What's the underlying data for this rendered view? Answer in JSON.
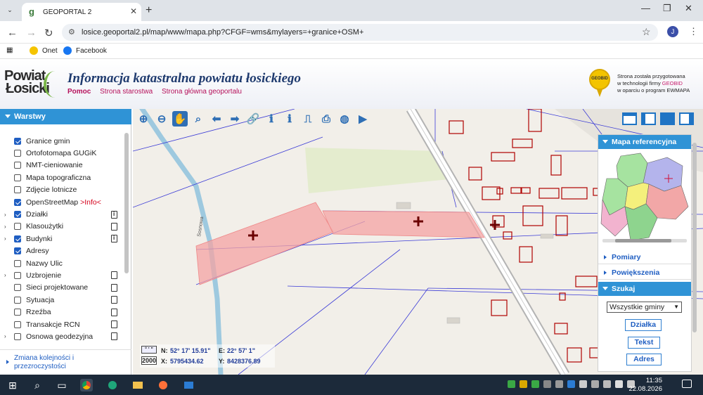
{
  "browser": {
    "tab_title": "GEOPORTAL 2",
    "favicon": "g",
    "url": "losice.geoportal2.pl/map/www/mapa.php?CFGF=wms&mylayers=+granice+OSM+",
    "profile_initial": "J",
    "bookmarks": [
      {
        "label": "Onet",
        "icon": "onet-icon",
        "color": "#f5c400"
      },
      {
        "label": "Facebook",
        "icon": "facebook-icon",
        "color": "#1877f2"
      }
    ]
  },
  "header": {
    "logo_line1": "Powiat",
    "logo_line2": "Łosicki",
    "title": "Informacja katastralna powiatu łosickiego",
    "links": [
      "Pomoc",
      "Strona starostwa",
      "Strona główna geoportalu"
    ],
    "geobid_badge": "GEOBID",
    "geobid_text1": "Strona została przygotowana",
    "geobid_text2_pre": "w technologii firmy ",
    "geobid_text2_link": "GEOBID",
    "geobid_text3": "w oparciu o program EWMAPA"
  },
  "left_panel": {
    "title": "Warstwy",
    "layers": [
      {
        "label": "Granice gmin",
        "checked": true,
        "expandable": false,
        "doc": ""
      },
      {
        "label": "Ortofotomapa GUGiK",
        "checked": false,
        "expandable": false,
        "doc": ""
      },
      {
        "label": "NMT-cieniowanie",
        "checked": false,
        "expandable": false,
        "doc": ""
      },
      {
        "label": "Mapa topograficzna",
        "checked": false,
        "expandable": false,
        "doc": ""
      },
      {
        "label": "Zdjęcie lotnicze",
        "checked": false,
        "expandable": false,
        "doc": ""
      },
      {
        "label": "OpenStreetMap",
        "info": ">Info<",
        "checked": true,
        "expandable": false,
        "doc": ""
      },
      {
        "label": "Działki",
        "checked": true,
        "expandable": true,
        "doc": "info"
      },
      {
        "label": "Klasoużytki",
        "checked": false,
        "expandable": true,
        "doc": "doc"
      },
      {
        "label": "Budynki",
        "checked": true,
        "expandable": true,
        "doc": "info"
      },
      {
        "label": "Adresy",
        "checked": true,
        "expandable": false,
        "doc": ""
      },
      {
        "label": "Nazwy Ulic",
        "checked": false,
        "expandable": false,
        "doc": ""
      },
      {
        "label": "Uzbrojenie",
        "checked": false,
        "expandable": true,
        "doc": "doc"
      },
      {
        "label": "Sieci projektowane",
        "checked": false,
        "expandable": false,
        "doc": "doc"
      },
      {
        "label": "Sytuacja",
        "checked": false,
        "expandable": false,
        "doc": "doc"
      },
      {
        "label": "Rzeźba",
        "checked": false,
        "expandable": false,
        "doc": "doc"
      },
      {
        "label": "Transakcje RCN",
        "checked": false,
        "expandable": false,
        "doc": "doc"
      },
      {
        "label": "Osnowa geodezyjna",
        "checked": false,
        "expandable": true,
        "doc": "doc"
      }
    ],
    "footer_line1": "Zmiana kolejności i",
    "footer_line2": "przezroczystości"
  },
  "map": {
    "road_label": "Sosnowa",
    "coords": {
      "format": "° ' \"",
      "scale": "2000",
      "n_label": "N:",
      "n_value": "52° 17' 15.91\"",
      "e_label": "E:",
      "e_value": "22° 57' 1\"",
      "x_label": "X:",
      "x_value": "5795434.62",
      "y_label": "Y:",
      "y_value": "8428376.89"
    },
    "toolbar": [
      "zoom-in-icon",
      "zoom-out-icon",
      "pan-hand-icon",
      "zoom-window-icon",
      "back-arrow-icon",
      "forward-arrow-icon",
      "link-icon",
      "info-icon",
      "info-extended-icon",
      "measure-icon",
      "print-icon",
      "globe-icon",
      "camera-icon"
    ]
  },
  "right_panel": {
    "ref_title": "Mapa referencyjna",
    "pomiary": "Pomiary",
    "powiekszenia": "Powiększenia",
    "szukaj": "Szukaj",
    "select_value": "Wszystkie gminy",
    "btn_dzialka": "Działka",
    "btn_tekst": "Tekst",
    "btn_adres": "Adres"
  },
  "taskbar": {
    "time": "11:35",
    "date": "22.08.2026"
  },
  "colors": {
    "accent": "#2f93d6",
    "link": "#1f5ec2",
    "parcel_highlight": "#f4a3a3",
    "parcel_border": "#b00000",
    "header_links": "#b5115b"
  }
}
